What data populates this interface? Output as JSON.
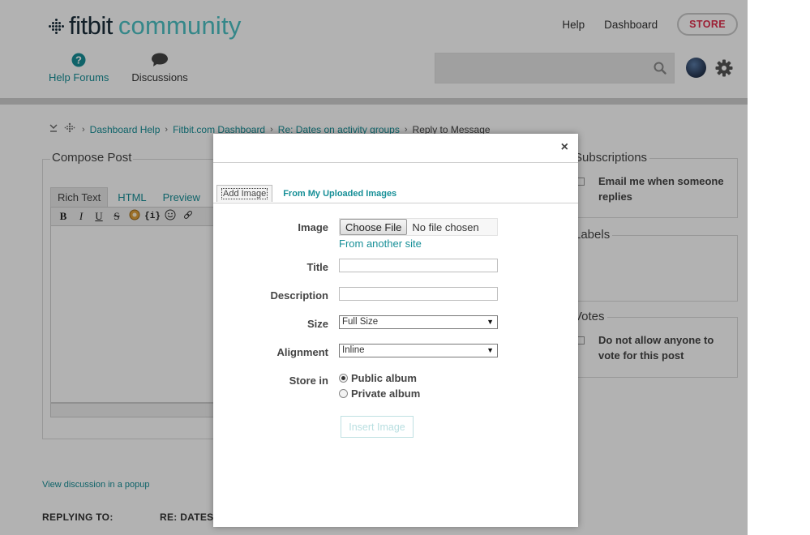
{
  "header": {
    "brand": "fitbit",
    "community": "community",
    "links": [
      "Help",
      "Dashboard"
    ],
    "store": "STORE"
  },
  "nav": {
    "help_forums": "Help Forums",
    "discussions": "Discussions"
  },
  "search": {
    "placeholder": ""
  },
  "breadcrumb": {
    "items": [
      "Dashboard Help",
      "Fitbit.com Dashboard",
      "Re: Dates on activity groups"
    ],
    "current": "Reply to Message"
  },
  "compose": {
    "legend": "Compose Post",
    "tabs": [
      "Rich Text",
      "HTML",
      "Preview"
    ],
    "toolbar": [
      "B",
      "I",
      "U",
      "S"
    ]
  },
  "footer": {
    "popup_link": "View discussion in a popup",
    "replying_label": "REPLYING TO:",
    "replying_value": "RE: DATES"
  },
  "sidebar": {
    "subscriptions_legend": "Subscriptions",
    "subscriptions_text": "Email me when someone replies",
    "labels_legend": "Labels",
    "votes_legend": "Votes",
    "votes_text": "Do not allow anyone to vote for this post"
  },
  "modal": {
    "close": "×",
    "tab_add": "Add Image",
    "tab_uploaded": "From My Uploaded Images",
    "image_label": "Image",
    "choose_file": "Choose File",
    "no_file": "No file chosen",
    "another_site": "From another site",
    "title_label": "Title",
    "title_value": "",
    "description_label": "Description",
    "description_value": "",
    "size_label": "Size",
    "size_value": "Full Size",
    "alignment_label": "Alignment",
    "alignment_value": "Inline",
    "store_label": "Store in",
    "public_album": "Public album",
    "private_album": "Private album",
    "insert": "Insert Image"
  },
  "colors": {
    "teal": "#168f97",
    "logo_community": "#4cc2c4",
    "store_red": "#e02d4b"
  }
}
